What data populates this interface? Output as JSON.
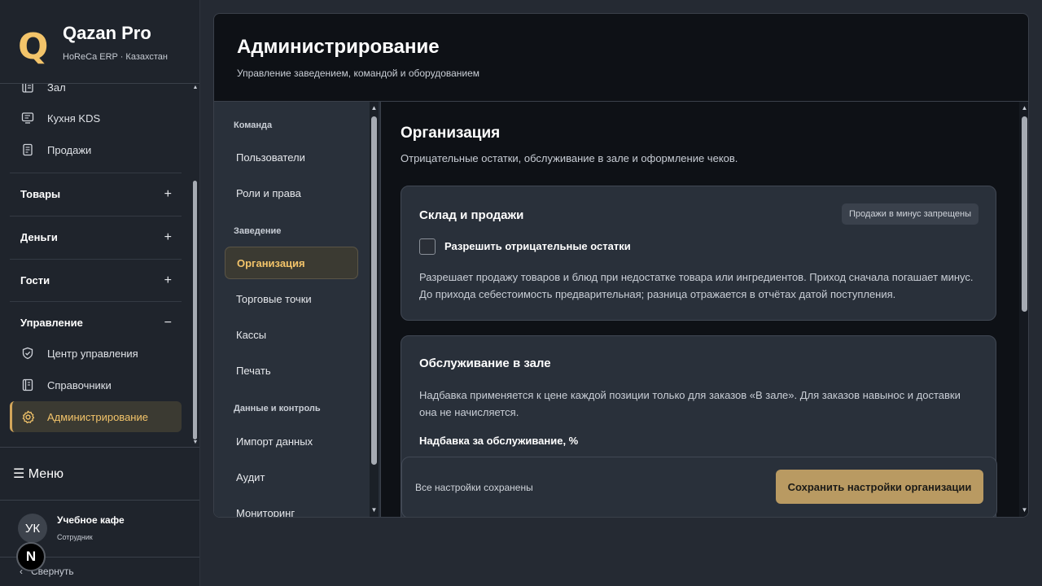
{
  "brand": {
    "logo": "Q",
    "name": "Qazan Pro",
    "subtitle": "HoReCa ERP · Казахстан"
  },
  "sidebar": {
    "items": [
      {
        "label": "Зал",
        "icon": "table-icon"
      },
      {
        "label": "Кухня KDS",
        "icon": "monitor-icon"
      },
      {
        "label": "Продажи",
        "icon": "receipt-icon"
      }
    ],
    "groups": [
      {
        "label": "Товары",
        "sign": "+"
      },
      {
        "label": "Деньги",
        "sign": "+"
      },
      {
        "label": "Гости",
        "sign": "+"
      },
      {
        "label": "Управление",
        "sign": "−"
      }
    ],
    "management_items": [
      {
        "label": "Центр управления",
        "icon": "shield-check-icon"
      },
      {
        "label": "Справочники",
        "icon": "book-icon"
      },
      {
        "label": "Администрирование",
        "icon": "gear-icon"
      }
    ],
    "menu_label": "☰ Меню",
    "user": {
      "initials": "УК",
      "name": "Учебное кафе",
      "role": "Сотрудник"
    },
    "badge": "N",
    "collapse_label": "Свернуть",
    "collapse_arrow": "‹"
  },
  "header": {
    "title": "Администрирование",
    "subtitle": "Управление заведением, командой и оборудованием"
  },
  "subnav": {
    "cat_team": "Команда",
    "users": "Пользователи",
    "roles": "Роли и права",
    "cat_venue": "Заведение",
    "organization": "Организация",
    "points": "Торговые точки",
    "registers": "Кассы",
    "print": "Печать",
    "cat_data": "Данные и контроль",
    "import": "Импорт данных",
    "audit": "Аудит",
    "monitoring": "Мониторинг"
  },
  "content": {
    "title": "Организация",
    "subtitle": "Отрицательные остатки, обслуживание в зале и оформление чеков.",
    "stock_card": {
      "title": "Склад и продажи",
      "tag": "Продажи в минус запрещены",
      "checkbox_label": "Разрешить отрицательные остатки",
      "text_line1": "Разрешает продажу товаров и блюд при недостатке товара или ингредиентов. Приход сначала погашает минус.",
      "text_line2": "До прихода себестоимость предварительная; разница отражается в отчётах датой поступления."
    },
    "service_card": {
      "title": "Обслуживание в зале",
      "text_line1": "Надбавка применяется к цене каждой позиции только для заказов «В зале». Для заказов навынос и доставки",
      "text_line2": "она не начисляется.",
      "field_label": "Надбавка за обслуживание, %"
    },
    "savebar": {
      "status": "Все настройки сохранены",
      "button": "Сохранить настройки организации"
    }
  },
  "colors": {
    "accent": "#f3c46a",
    "button": "#b99a62",
    "panel": "#0e1116",
    "card": "#29303a"
  }
}
